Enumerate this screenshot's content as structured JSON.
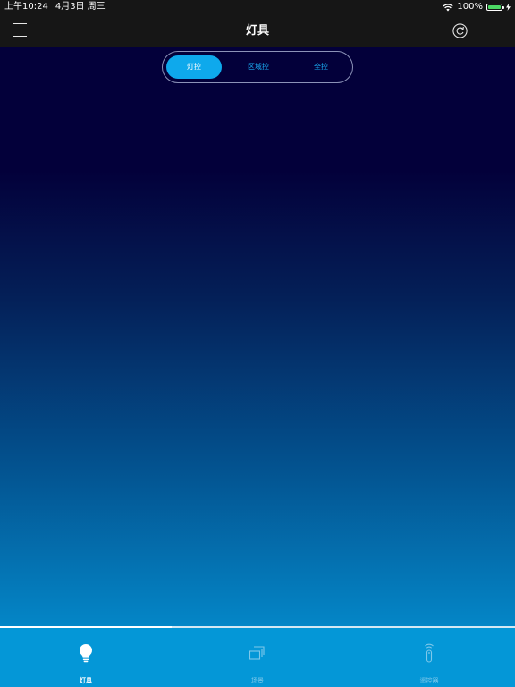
{
  "status_bar": {
    "time": "上午10:24",
    "date": "4月3日 周三",
    "battery": "100%"
  },
  "nav": {
    "title": "灯具",
    "left_icon": "menu-icon",
    "right_icon": "refresh-icon"
  },
  "segments": {
    "items": [
      {
        "label": "灯控",
        "active": true
      },
      {
        "label": "区域控",
        "active": false
      },
      {
        "label": "全控",
        "active": false
      }
    ]
  },
  "tabs": {
    "items": [
      {
        "label": "灯具",
        "icon": "bulb-icon",
        "active": true
      },
      {
        "label": "场景",
        "icon": "scene-icon",
        "active": false
      },
      {
        "label": "遥控器",
        "icon": "remote-icon",
        "active": false
      }
    ]
  },
  "colors": {
    "accent": "#0ea9ec",
    "tab_bar": "#0497d7",
    "header": "#161616",
    "background_top": "#03003a",
    "background_bottom": "#0490d2"
  }
}
